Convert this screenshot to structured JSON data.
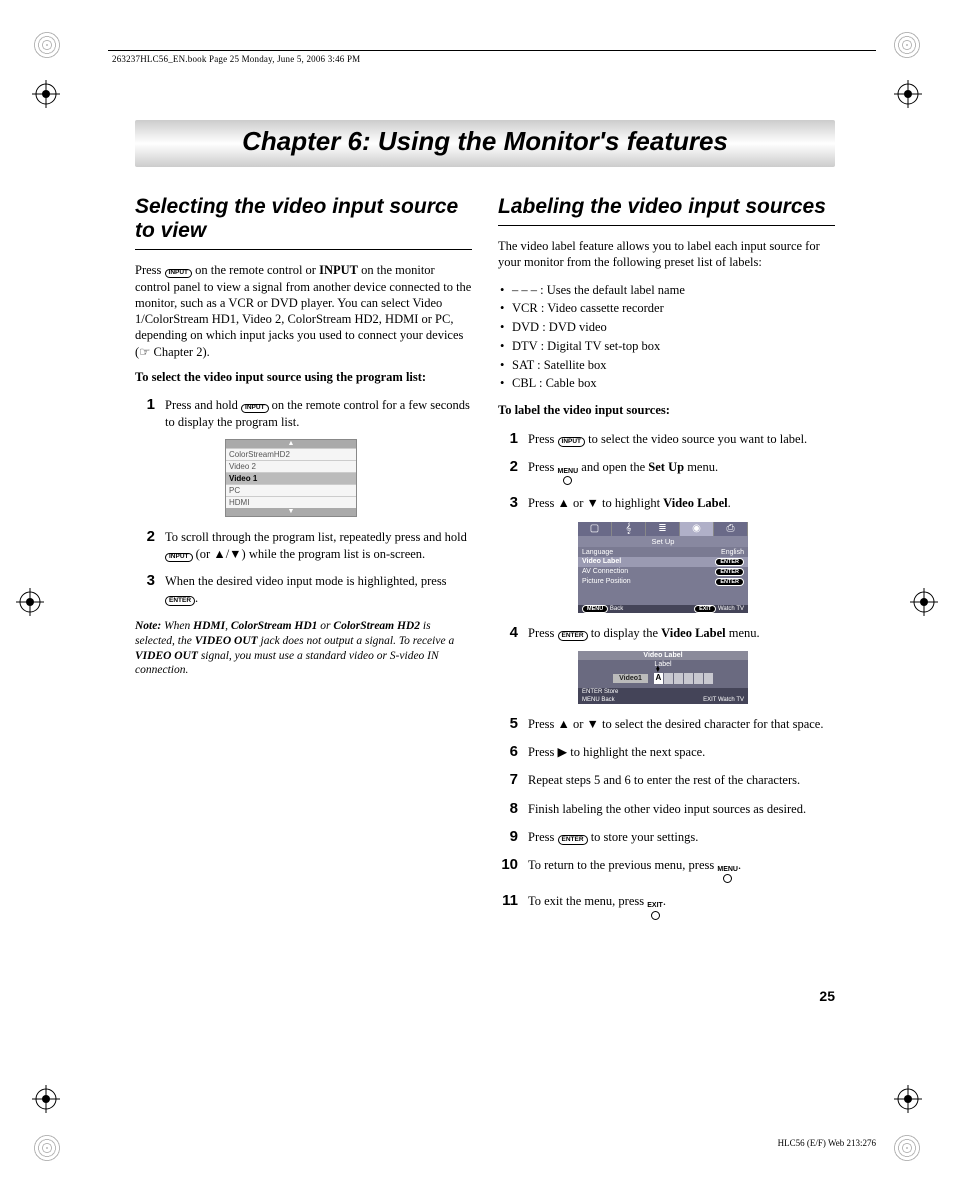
{
  "header_meta": "263237HLC56_EN.book  Page 25  Monday, June 5, 2006  3:46 PM",
  "chapter_title": "Chapter 6: Using the Monitor's features",
  "left": {
    "section_title": "Selecting the video input source to view",
    "para1_a": "Press ",
    "para1_btn": "INPUT",
    "para1_b": " on the remote control or ",
    "para1_bold": "INPUT",
    "para1_c": " on the monitor control panel to view a signal from another device connected to the monitor, such as a VCR or DVD player. You can select Video 1/ColorStream HD1, Video 2, ColorStream HD2, HDMI or PC, depending on which input jacks you used to connect your devices (☞ Chapter 2).",
    "subhead": "To select the video input source using the program list:",
    "steps": [
      {
        "n": "1",
        "a": "Press and hold ",
        "btn": "INPUT",
        "b": " on the remote control for a few seconds to display the program list."
      },
      {
        "n": "2",
        "a": "To scroll through the program list, repeatedly press and hold ",
        "btn": "INPUT",
        "b": "  (or ▲/▼) while the program list is on-screen."
      },
      {
        "n": "3",
        "a": "When the desired video input mode is highlighted, press ",
        "btn": "ENTER",
        "b": "."
      }
    ],
    "prog_list": [
      "ColorStreamHD2",
      "Video 2",
      "Video 1",
      "PC",
      "HDMI"
    ],
    "prog_list_selected": "Video 1",
    "note_lead": "Note:",
    "note_a": " When ",
    "note_b1": "HDMI",
    "note_c": ", ",
    "note_b2": "ColorStream HD1",
    "note_d": " or ",
    "note_b3": "ColorStream HD2",
    "note_e": " is selected, the ",
    "note_b4": "VIDEO OUT",
    "note_f": " jack does not output a signal. To receive a ",
    "note_b5": "VIDEO OUT",
    "note_g": " signal, you must use a standard video or S-video IN connection."
  },
  "right": {
    "section_title": "Labeling the video input sources",
    "para1": "The video label feature allows you to label each input source for your monitor from the following preset list of labels:",
    "bullets": [
      "– – –  : Uses the default label name",
      "VCR  : Video cassette recorder",
      "DVD : DVD video",
      "DTV  : Digital TV set-top box",
      "SAT  : Satellite box",
      "CBL  : Cable box"
    ],
    "subhead": "To label the video input sources:",
    "steps": [
      {
        "n": "1",
        "a": "Press ",
        "btn": "INPUT",
        "b": " to select the video source you want to label."
      },
      {
        "n": "2",
        "a": "Press ",
        "lbl": "MENU",
        "b": " and open the ",
        "bold": "Set Up",
        "c": " menu."
      },
      {
        "n": "3",
        "a": "Press ▲ or ▼ to highlight ",
        "bold": "Video Label",
        "b": "."
      },
      {
        "n": "4",
        "a": "Press ",
        "btn": "ENTER",
        "b": " to display the ",
        "bold": "Video Label",
        "c": " menu."
      },
      {
        "n": "5",
        "a": "Press ▲ or ▼ to select the desired character for that space."
      },
      {
        "n": "6",
        "a": "Press ▶ to highlight the next space."
      },
      {
        "n": "7",
        "a": "Repeat steps 5 and 6 to enter the rest of the characters."
      },
      {
        "n": "8",
        "a": "Finish labeling the other video input sources as desired."
      },
      {
        "n": "9",
        "a": "Press ",
        "btn": "ENTER",
        "b": " to store your settings."
      },
      {
        "n": "10",
        "a": "To return to the previous menu, press ",
        "lbl": "MENU",
        "b": "."
      },
      {
        "n": "11",
        "a": "To exit the menu, press ",
        "lbl": "EXIT",
        "b": "."
      }
    ],
    "setup_menu": {
      "title": "Set Up",
      "rows": [
        {
          "label": "Language",
          "value": "English"
        },
        {
          "label": "Video Label",
          "value": "ENTER",
          "sel": true
        },
        {
          "label": "AV Connection",
          "value": "ENTER"
        },
        {
          "label": "Picture Position",
          "value": "ENTER"
        }
      ],
      "footer_left_btn": "MENU",
      "footer_left": "Back",
      "footer_right_btn": "EXIT",
      "footer_right": "Watch TV"
    },
    "label_menu": {
      "title": "Video Label",
      "subtitle": "Label",
      "source": "Video1",
      "first_char": "A",
      "f1_left_btn": "ENTER",
      "f1_left": "Store",
      "f2_left_btn": "MENU",
      "f2_left": "Back",
      "f2_right_btn": "EXIT",
      "f2_right": "Watch TV"
    }
  },
  "page_number": "25",
  "footer_meta": "HLC56 (E/F) Web 213:276"
}
